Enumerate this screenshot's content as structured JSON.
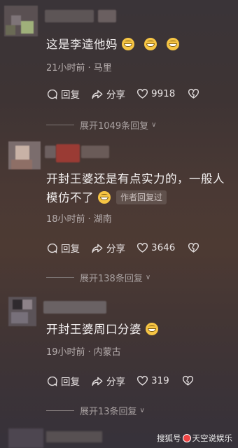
{
  "comments": [
    {
      "text": "这是李逵他妈",
      "emoji_count": 3,
      "time": "21小时前",
      "location": "马里",
      "reply_label": "回复",
      "share_label": "分享",
      "likes": "9918",
      "expand": "展开1049条回复"
    },
    {
      "text": "开封王婆还是有点实力的，一般人模仿不了",
      "emoji": "laughing-tears-emoji",
      "badge": "作者回复过",
      "time": "18小时前",
      "location": "湖南",
      "reply_label": "回复",
      "share_label": "分享",
      "likes": "3646",
      "expand": "展开138条回复"
    },
    {
      "text": "开封王婆周口分婆",
      "emoji": "tongue-out-emoji",
      "time": "19小时前",
      "location": "内蒙古",
      "reply_label": "回复",
      "share_label": "分享",
      "likes": "319",
      "expand": "展开13条回复"
    }
  ],
  "watermark": {
    "left": "搜狐号",
    "right": "天空说娱乐"
  },
  "colors": {
    "text": "#f4f1f1",
    "meta": "#b6aeae",
    "badge_bg": "rgba(255,255,255,0.12)"
  }
}
